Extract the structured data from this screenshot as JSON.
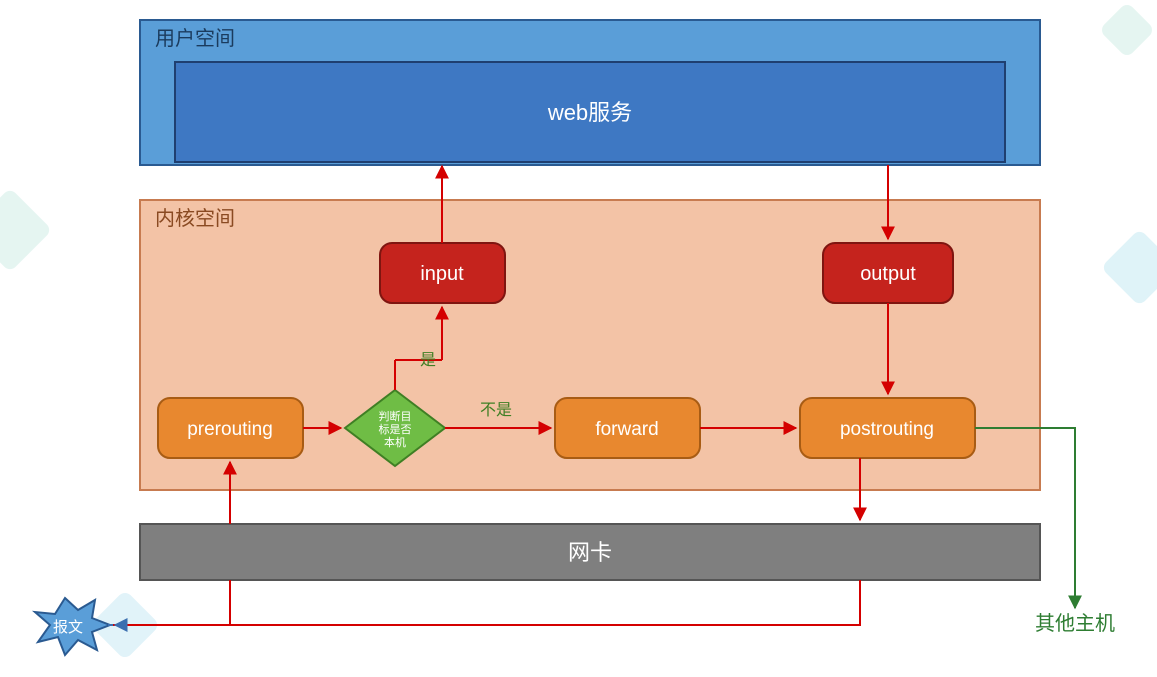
{
  "zones": {
    "user_space": "用户空间",
    "web_service": "web服务",
    "kernel_space": "内核空间",
    "nic": "网卡"
  },
  "chains": {
    "input": "input",
    "output": "output",
    "prerouting": "prerouting",
    "forward": "forward",
    "postrouting": "postrouting"
  },
  "decision": {
    "label": "判断目标是否本机",
    "yes": "是",
    "no": "不是"
  },
  "endpoints": {
    "packet": "报文",
    "other_hosts": "其他主机"
  },
  "colors": {
    "user_outer": "#5a9ed8",
    "user_inner": "#3e78c3",
    "kernel_bg": "#f3c3a6",
    "orange": "#e8882f",
    "red": "#c5231d",
    "green": "#6fbd45",
    "gray": "#7f7f7f",
    "arrow": "#d40000",
    "out_arrow": "#2e7d32"
  }
}
